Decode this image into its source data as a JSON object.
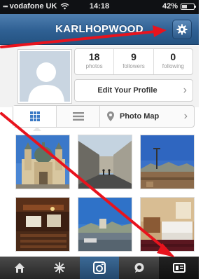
{
  "status_bar": {
    "signal": "▪▪▪",
    "carrier": "vodafone UK",
    "time": "14:18",
    "battery": "42%",
    "battery_level": 0.42
  },
  "nav": {
    "title": "KARLHOPWOOD",
    "settings_icon": "gear-icon"
  },
  "profile": {
    "avatar_icon": "avatar-placeholder-icon",
    "stats": [
      {
        "value": "18",
        "label": "photos"
      },
      {
        "value": "9",
        "label": "followers"
      },
      {
        "value": "0",
        "label": "following"
      }
    ],
    "edit_button": "Edit Your Profile"
  },
  "view_toggle": {
    "grid_icon": "grid-icon",
    "list_icon": "list-icon",
    "map_icon": "map-pin-icon",
    "map_label": "Photo Map"
  },
  "photos": [
    {
      "name": "photo-cathedral"
    },
    {
      "name": "photo-street"
    },
    {
      "name": "photo-harbour"
    },
    {
      "name": "photo-lecture-hall"
    },
    {
      "name": "photo-waterfront"
    },
    {
      "name": "photo-hotel-room"
    }
  ],
  "tab_bar": {
    "tabs": [
      {
        "name": "home-tab",
        "icon": "home-icon"
      },
      {
        "name": "explore-tab",
        "icon": "star-icon"
      },
      {
        "name": "camera-tab",
        "icon": "camera-icon"
      },
      {
        "name": "news-tab",
        "icon": "speech-bubble-icon"
      },
      {
        "name": "profile-tab",
        "icon": "profile-card-icon"
      }
    ]
  },
  "annotation_color": "#e8131d"
}
